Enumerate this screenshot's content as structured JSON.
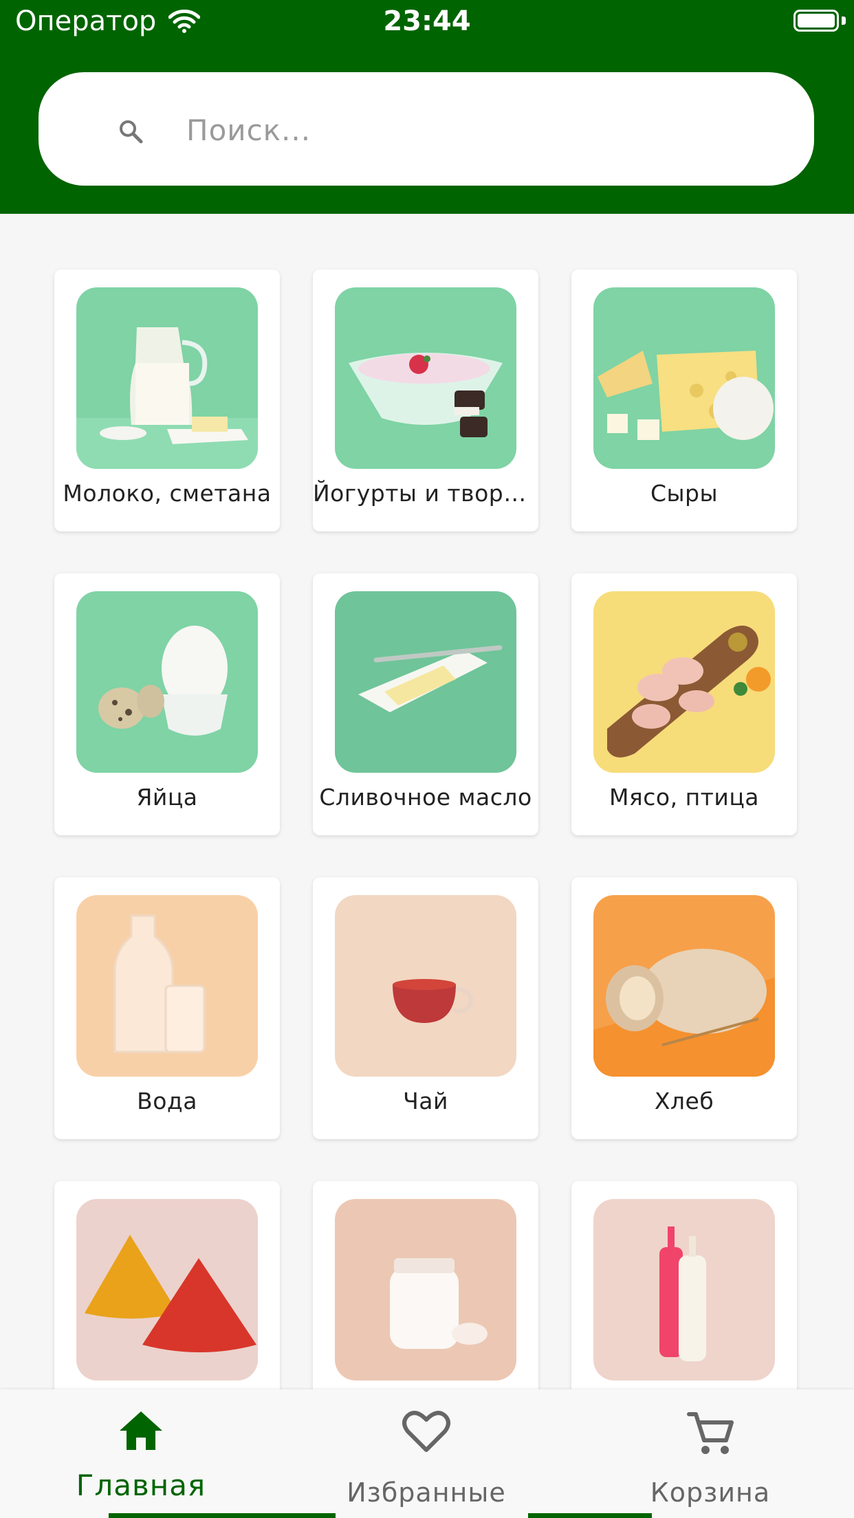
{
  "status_bar": {
    "carrier": "Оператор",
    "time": "23:44"
  },
  "search": {
    "placeholder": "Поиск..."
  },
  "categories": [
    {
      "label": "Молоко, сметана",
      "icon": "milk-jug-image"
    },
    {
      "label": "Йогурты и творо...",
      "icon": "yogurt-bowl-image"
    },
    {
      "label": "Сыры",
      "icon": "cheese-image"
    },
    {
      "label": "Яйца",
      "icon": "eggs-image"
    },
    {
      "label": "Сливочное масло",
      "icon": "butter-image"
    },
    {
      "label": "Мясо, птица",
      "icon": "chicken-board-image"
    },
    {
      "label": "Вода",
      "icon": "water-bottle-image"
    },
    {
      "label": "Чай",
      "icon": "tea-cup-image"
    },
    {
      "label": "Хлеб",
      "icon": "bread-image"
    },
    {
      "label": "",
      "icon": "spices-image"
    },
    {
      "label": "",
      "icon": "flour-jar-image"
    },
    {
      "label": "",
      "icon": "sauce-bottles-image"
    }
  ],
  "bottom_nav": {
    "home": "Главная",
    "favorites": "Избранные",
    "cart": "Корзина"
  },
  "colors": {
    "brand_green": "#006400",
    "background": "#f6f6f6"
  }
}
